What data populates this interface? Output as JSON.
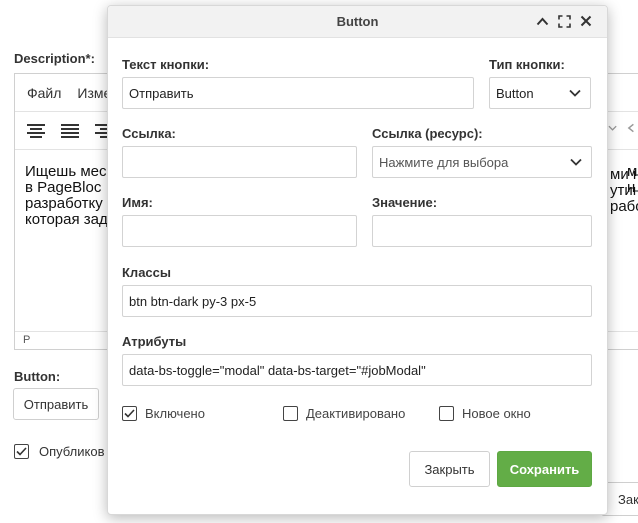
{
  "background": {
    "description_label": "Description*:",
    "menubar": {
      "file": "Файл",
      "edit": "Изме"
    },
    "content_lines": [
      "Ищешь мес",
      "в PageBloc",
      "разработку",
      "которая зад"
    ],
    "content_right_lines": [
      "ми н",
      "утину",
      "работ"
    ],
    "status_path": "P",
    "button_label": "Button:",
    "button_value": "Отправить",
    "published_label": "Опубликов",
    "corner_button": "Зак"
  },
  "modal": {
    "title": "Button",
    "fields": {
      "button_text_label": "Текст кнопки:",
      "button_text_value": "Отправить",
      "button_type_label": "Тип кнопки:",
      "button_type_value": "Button",
      "link_label": "Ссылка:",
      "link_value": "",
      "link_resource_label": "Ссылка (ресурс):",
      "link_resource_placeholder": "Нажмите для выбора",
      "name_label": "Имя:",
      "name_value": "",
      "value_label": "Значение:",
      "value_value": "",
      "classes_label": "Классы",
      "classes_value": "btn btn-dark py-3 px-5",
      "attributes_label": "Атрибуты",
      "attributes_value": "data-bs-toggle=\"modal\" data-bs-target=\"#jobModal\""
    },
    "checkboxes": {
      "enabled_label": "Включено",
      "enabled_checked": true,
      "disabled_label": "Деактивировано",
      "disabled_checked": false,
      "new_window_label": "Новое окно",
      "new_window_checked": false
    },
    "buttons": {
      "close": "Закрыть",
      "save": "Сохранить"
    }
  },
  "colors": {
    "save_button": "#63ad47",
    "header_bg": "#f2f2f2"
  },
  "icons": {
    "collapse": "chevron-up-icon",
    "expand": "expand-icon",
    "close": "close-icon",
    "dropdown": "chevron-down-icon",
    "check": "check-icon"
  }
}
